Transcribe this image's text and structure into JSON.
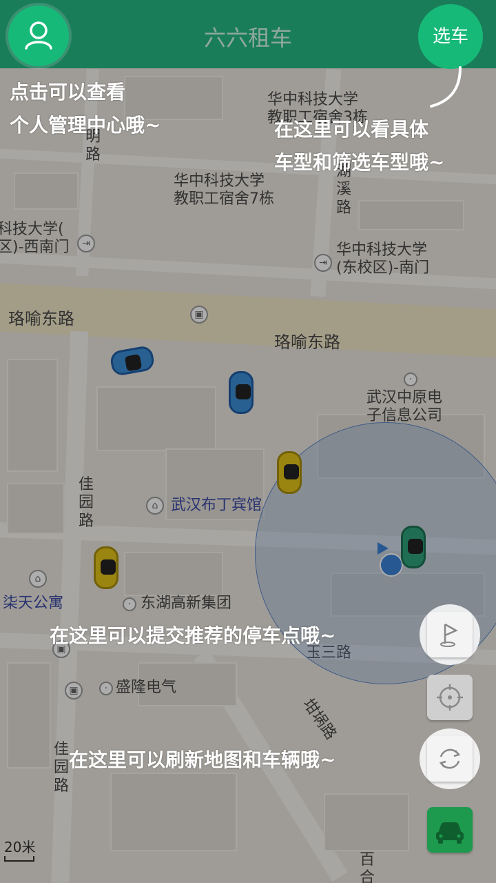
{
  "header": {
    "title": "六六租车",
    "select_car_label": "选车",
    "user_icon": "user-icon"
  },
  "map": {
    "labels": {
      "hust_staff_3": "华中科技大学\n教职工宿舍3栋",
      "hust_staff_7": "华中科技大学\n教职工宿舍7栋",
      "hust_west": "科技大学(\n区)-西南门",
      "hust_east": "华中科技大学\n(东校区)-南门",
      "luoyu_west": "珞喻东路",
      "luoyu_east": "珞喻东路",
      "zhongyuan": "武汉中原电\n子信息公司",
      "budding": "武汉布丁宾馆",
      "qitian": "柒天公寓",
      "donghu": "东湖高新集团",
      "shenglong": "盛隆电气",
      "jiayuan_1": "佳园路",
      "jiayuan_2": "佳园路",
      "hu_xi": "湖溪路",
      "ming": "明路",
      "yusan": "玉三路",
      "tanzhu": "坩埚路",
      "bai": "百合",
      "scale": "20米"
    }
  },
  "guides": {
    "personal_center": "点击可以查看\n个人管理中心哦~",
    "car_models": "在这里可以看具体\n车型和筛选车型哦~",
    "parking": "在这里可以提交推荐的停车点哦~",
    "refresh": "在这里可以刷新地图和车辆哦~"
  },
  "controls": {
    "flag_icon": "flag-icon",
    "locate_icon": "locate-icon",
    "refresh_icon": "refresh-icon",
    "car_icon": "car-icon"
  },
  "colors": {
    "header": "#1a7d5a",
    "accent": "#17b978",
    "car_blue": "#3c8ed6",
    "car_yellow": "#e4c51a",
    "car_green": "#2fa37b"
  }
}
